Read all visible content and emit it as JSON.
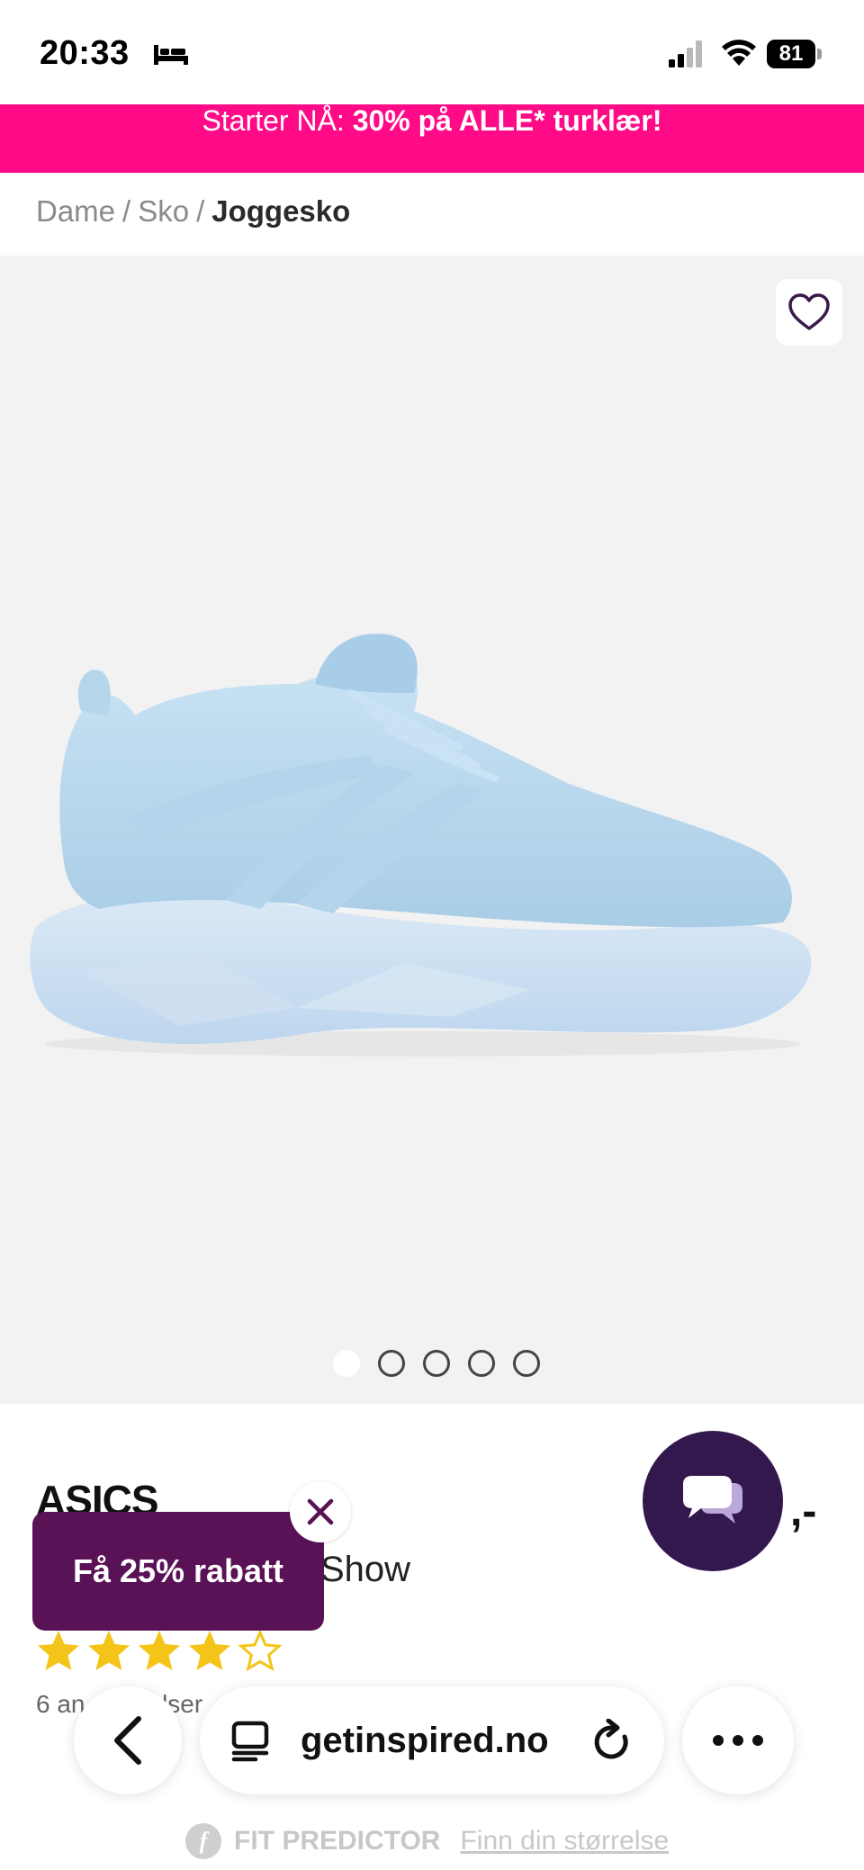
{
  "status_bar": {
    "time": "20:33",
    "battery": "81"
  },
  "promo": {
    "prefix": "Starter NÅ: ",
    "highlight": "30% på ALLE* turklær!"
  },
  "breadcrumb": {
    "items": [
      "Dame",
      "Sko"
    ],
    "separator": "/",
    "current": "Joggesko"
  },
  "gallery": {
    "image_count": 5,
    "active_index": 0,
    "image_icon": "running-shoe-light-blue"
  },
  "product": {
    "brand": "ASICS",
    "name_visible": "Show",
    "price_visible": ",-",
    "rating": 4,
    "rating_max": 5,
    "reviews_visible": "6 an",
    "reviews_visible_end": "lser"
  },
  "discount_popup": {
    "label": "Få 25% rabatt"
  },
  "browser": {
    "url": "getinspired.no"
  },
  "fit_predictor": {
    "label": "FIT PREDICTOR",
    "link": "Finn din størrelse"
  },
  "colors": {
    "promo": "#ff0a87",
    "chat": "#33184d",
    "discount": "#5a1256",
    "star": "#f4c518",
    "shoe": "#bcd9ee"
  }
}
